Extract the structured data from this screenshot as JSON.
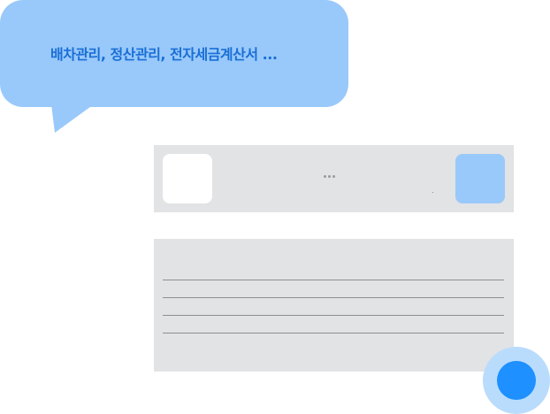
{
  "bubble": {
    "text": "배차관리, 정산관리, 전자세금계산서 ..."
  },
  "colors": {
    "bubble_bg": "#99c9fa",
    "bubble_text": "#1a6fd6",
    "panel_bg": "#e2e3e5",
    "accent_square": "#99c9fa",
    "fab_outer": "#b9dcfd",
    "fab_inner": "#1e90ff"
  },
  "icons": {
    "more": "more-dots-icon"
  }
}
